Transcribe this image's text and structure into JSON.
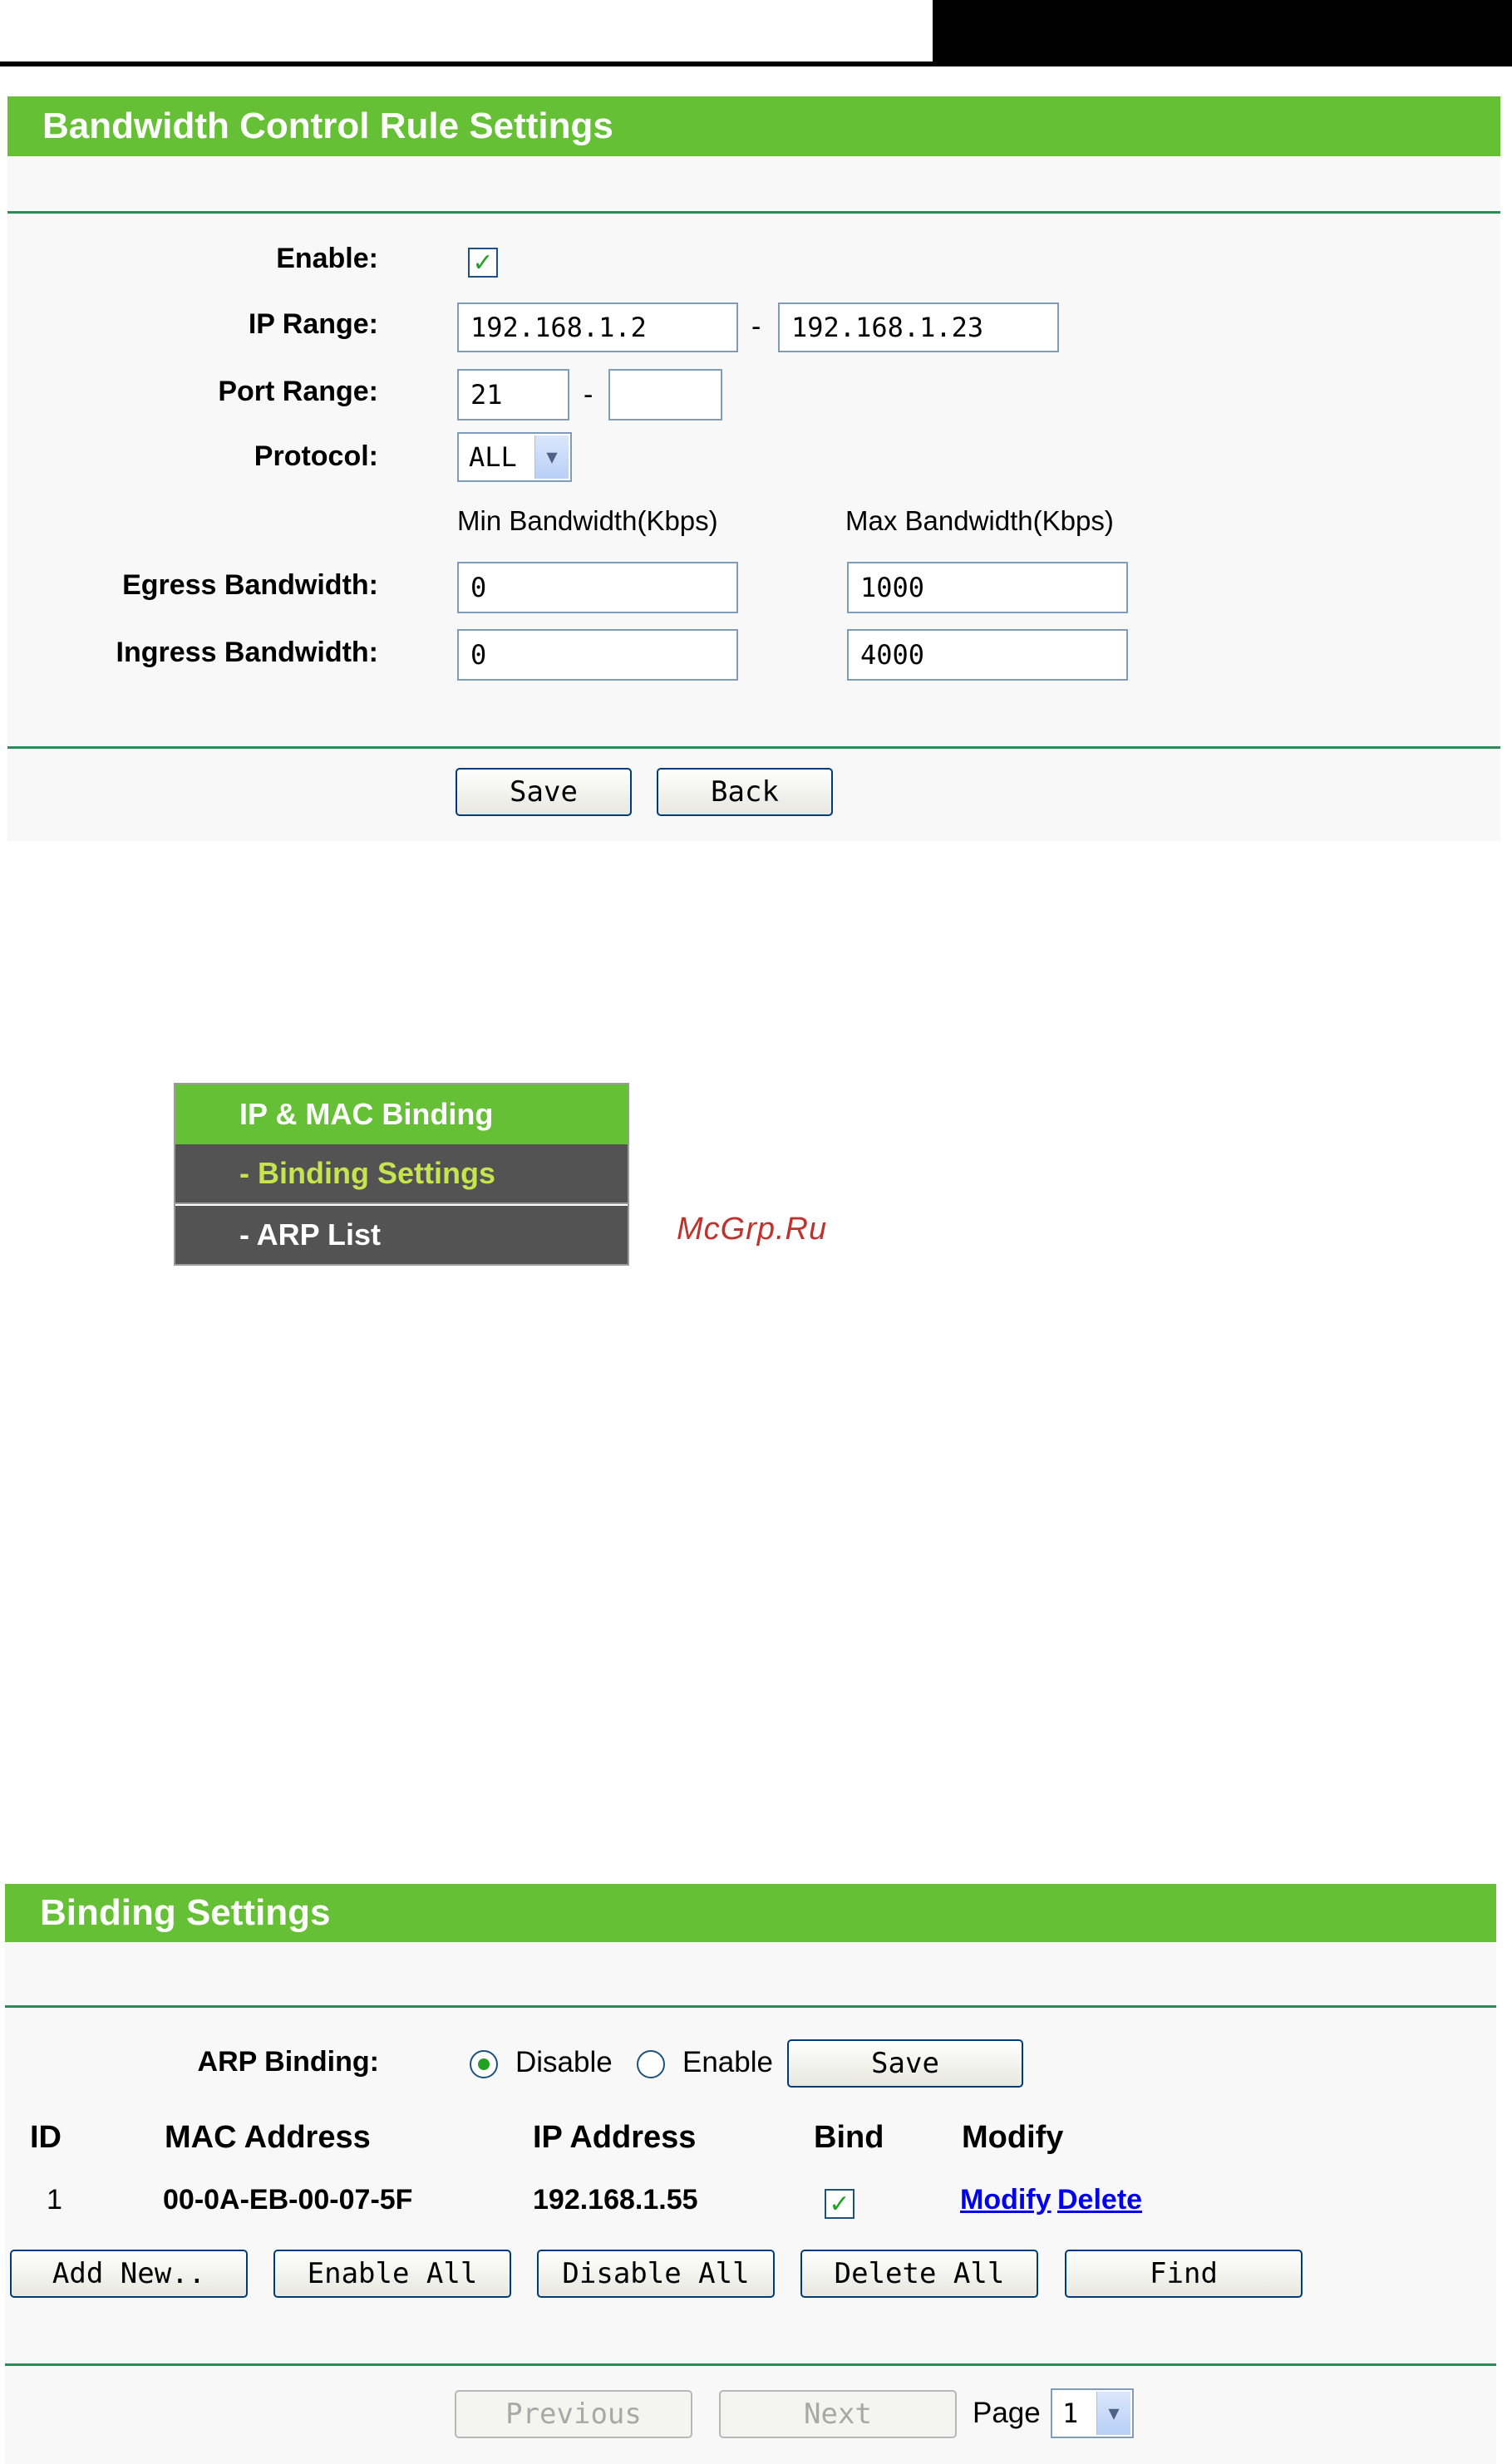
{
  "bandwidth": {
    "title": "Bandwidth Control Rule Settings",
    "enable_label": "Enable:",
    "enable_checked": true,
    "ip_range_label": "IP Range:",
    "ip_start": "192.168.1.2",
    "ip_end": "192.168.1.23",
    "port_range_label": "Port Range:",
    "port_start": "21",
    "port_end": "",
    "protocol_label": "Protocol:",
    "protocol_value": "ALL",
    "min_header": "Min Bandwidth(Kbps)",
    "max_header": "Max Bandwidth(Kbps)",
    "egress_label": "Egress Bandwidth:",
    "egress_min": "0",
    "egress_max": "1000",
    "ingress_label": "Ingress Bandwidth:",
    "ingress_min": "0",
    "ingress_max": "4000",
    "separator": "-",
    "save_label": "Save",
    "back_label": "Back"
  },
  "menu": {
    "title": "IP & MAC Binding",
    "items": [
      "- Binding Settings",
      "- ARP List"
    ]
  },
  "watermark": "McGrp.Ru",
  "binding": {
    "title": "Binding Settings",
    "arp_label": "ARP Binding:",
    "disable_label": "Disable",
    "enable_label": "Enable",
    "selected": "Disable",
    "save_label": "Save",
    "columns": [
      "ID",
      "MAC Address",
      "IP Address",
      "Bind",
      "Modify"
    ],
    "rows": [
      {
        "id": "1",
        "mac": "00-0A-EB-00-07-5F",
        "ip": "192.168.1.55",
        "bind": true,
        "modify": "Modify",
        "delete": "Delete"
      }
    ],
    "buttons": [
      "Add New..",
      "Enable All",
      "Disable All",
      "Delete All",
      "Find"
    ],
    "previous_label": "Previous",
    "next_label": "Next",
    "page_label": "Page",
    "page_value": "1"
  },
  "icons": {
    "checkmark": "check-icon",
    "dropdown": "chevron-down-icon"
  }
}
